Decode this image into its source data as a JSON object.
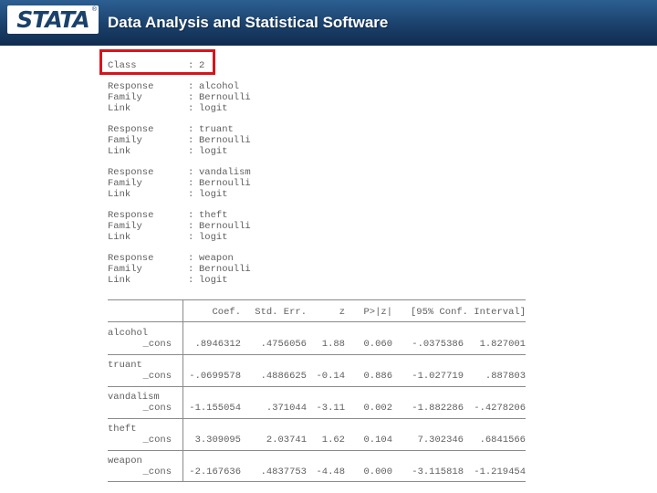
{
  "header": {
    "logo_text": "STATA",
    "logo_reg": "®",
    "tagline": "Data Analysis and Statistical Software",
    "colors": {
      "banner_top": "#2c5f93",
      "banner_bottom": "#102c4f",
      "highlight": "#d8141b"
    }
  },
  "class_line": {
    "label": "Class",
    "sep": ":",
    "value": "2"
  },
  "blocks": [
    {
      "response": "alcohol",
      "family": "Bernoulli",
      "link": "logit"
    },
    {
      "response": "truant",
      "family": "Bernoulli",
      "link": "logit"
    },
    {
      "response": "vandalism",
      "family": "Bernoulli",
      "link": "logit"
    },
    {
      "response": "theft",
      "family": "Bernoulli",
      "link": "logit"
    },
    {
      "response": "weapon",
      "family": "Bernoulli",
      "link": "logit"
    }
  ],
  "labels": {
    "response": "Response",
    "family": "Family",
    "link": "Link",
    "sep": ":"
  },
  "table": {
    "columns": [
      "Coef.",
      "Std. Err.",
      "z",
      "P>|z|",
      "[95% Conf. Interval]"
    ],
    "rows": [
      {
        "name": "alcohol",
        "term": "_cons",
        "coef": ".8946312",
        "se": ".4756056",
        "z": "1.88",
        "p": "0.060",
        "lo": "-.0375386",
        "hi": "1.827001"
      },
      {
        "name": "truant",
        "term": "_cons",
        "coef": "-.0699578",
        "se": ".4886625",
        "z": "-0.14",
        "p": "0.886",
        "lo": "-1.027719",
        "hi": ".887803"
      },
      {
        "name": "vandalism",
        "term": "_cons",
        "coef": "-1.155054",
        "se": ".371044",
        "z": "-3.11",
        "p": "0.002",
        "lo": "-1.882286",
        "hi": "-.4278206"
      },
      {
        "name": "theft",
        "term": "_cons",
        "coef": "3.309095",
        "se": "2.03741",
        "z": "1.62",
        "p": "0.104",
        "lo": "7.302346",
        "hi": ".6841566"
      },
      {
        "name": "weapon",
        "term": "_cons",
        "coef": "-2.167636",
        "se": ".4837753",
        "z": "-4.48",
        "p": "0.000",
        "lo": "-3.115818",
        "hi": "-1.219454"
      }
    ]
  }
}
